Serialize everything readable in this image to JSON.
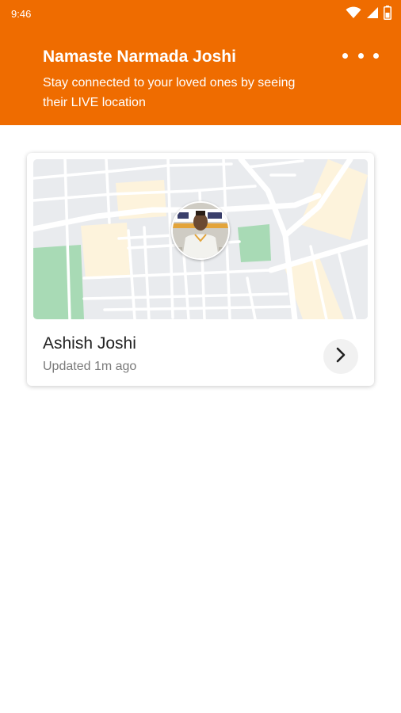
{
  "status_bar": {
    "time": "9:46",
    "icons": [
      "wifi-icon",
      "signal-icon",
      "battery-icon"
    ]
  },
  "header": {
    "greeting": "Namaste Narmada Joshi",
    "subtitle": "Stay connected to your loved ones by seeing their LIVE location",
    "menu_icon": "more-dots-icon"
  },
  "contacts": [
    {
      "name": "Ashish Joshi",
      "updated": "Updated 1m ago",
      "action_icon": "chevron-right-icon"
    }
  ],
  "colors": {
    "brand": "#EF6C00",
    "map_background": "#E9EBEE",
    "map_park": "#A8DAB5",
    "map_building": "#FDF3DC"
  }
}
